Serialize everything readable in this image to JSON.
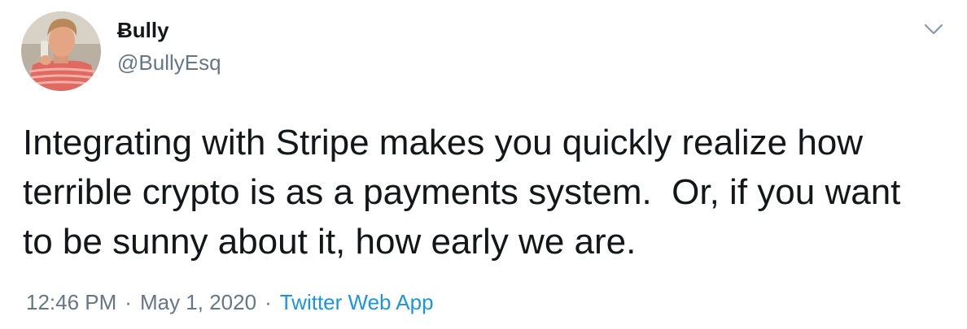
{
  "tweet": {
    "author": {
      "display_name": "Ƀully",
      "handle": "@BullyEsq",
      "avatar": "avatar-photo"
    },
    "menu_icon": "chevron-down-icon",
    "text": "Integrating with Stripe makes you quickly realize how\nterrible crypto is as a payments system.  Or, if you want\nto be sunny about it, how early we are.",
    "meta": {
      "time": "12:46 PM",
      "separator": "·",
      "date": "May 1, 2020",
      "source": "Twitter Web App"
    }
  },
  "colors": {
    "text": "#14171a",
    "secondary": "#657786",
    "link": "#1b95e0",
    "background": "#ffffff"
  }
}
